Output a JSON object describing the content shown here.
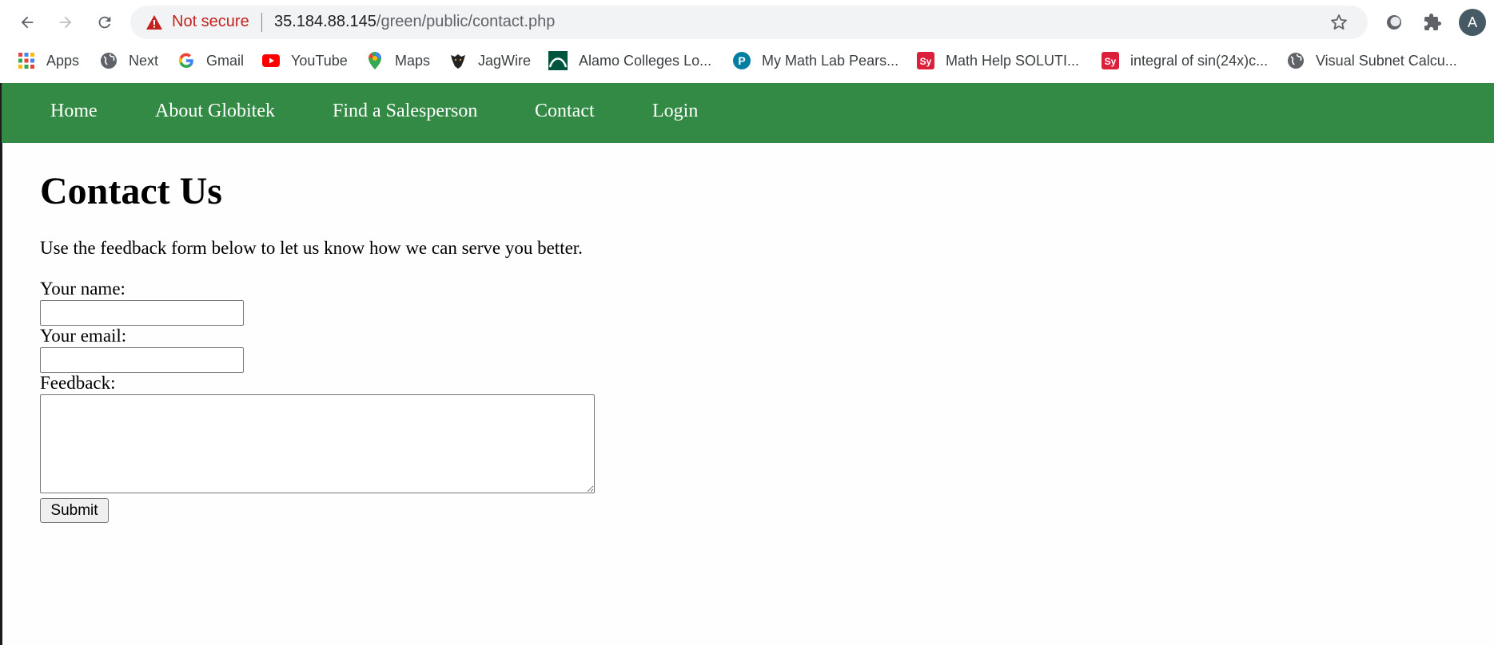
{
  "browser": {
    "security_label": "Not secure",
    "url_host": "35.184.88.145",
    "url_path": "/green/public/contact.php",
    "profile_initial": "A",
    "bookmarks": [
      {
        "label": "Apps",
        "icon": "apps-grid-icon"
      },
      {
        "label": "Next",
        "icon": "globe-icon"
      },
      {
        "label": "Gmail",
        "icon": "google-icon"
      },
      {
        "label": "YouTube",
        "icon": "youtube-icon"
      },
      {
        "label": "Maps",
        "icon": "maps-pin-icon"
      },
      {
        "label": "JagWire",
        "icon": "jaguar-icon"
      },
      {
        "label": "Alamo Colleges Lo...",
        "icon": "alamo-colleges-icon"
      },
      {
        "label": "My Math Lab Pears...",
        "icon": "pearson-icon"
      },
      {
        "label": "Math Help SOLUTI...",
        "icon": "symbolab-icon"
      },
      {
        "label": "integral of sin(24x)c...",
        "icon": "symbolab-icon"
      },
      {
        "label": "Visual Subnet Calcu...",
        "icon": "globe-icon"
      }
    ]
  },
  "site_nav": {
    "items": [
      "Home",
      "About Globitek",
      "Find a Salesperson",
      "Contact",
      "Login"
    ],
    "color": "#338a45"
  },
  "page": {
    "title": "Contact Us",
    "intro": "Use the feedback form below to let us know how we can serve you better.",
    "form": {
      "name_label": "Your name:",
      "name_value": "",
      "email_label": "Your email:",
      "email_value": "",
      "feedback_label": "Feedback:",
      "feedback_value": "",
      "submit_label": "Submit"
    }
  }
}
